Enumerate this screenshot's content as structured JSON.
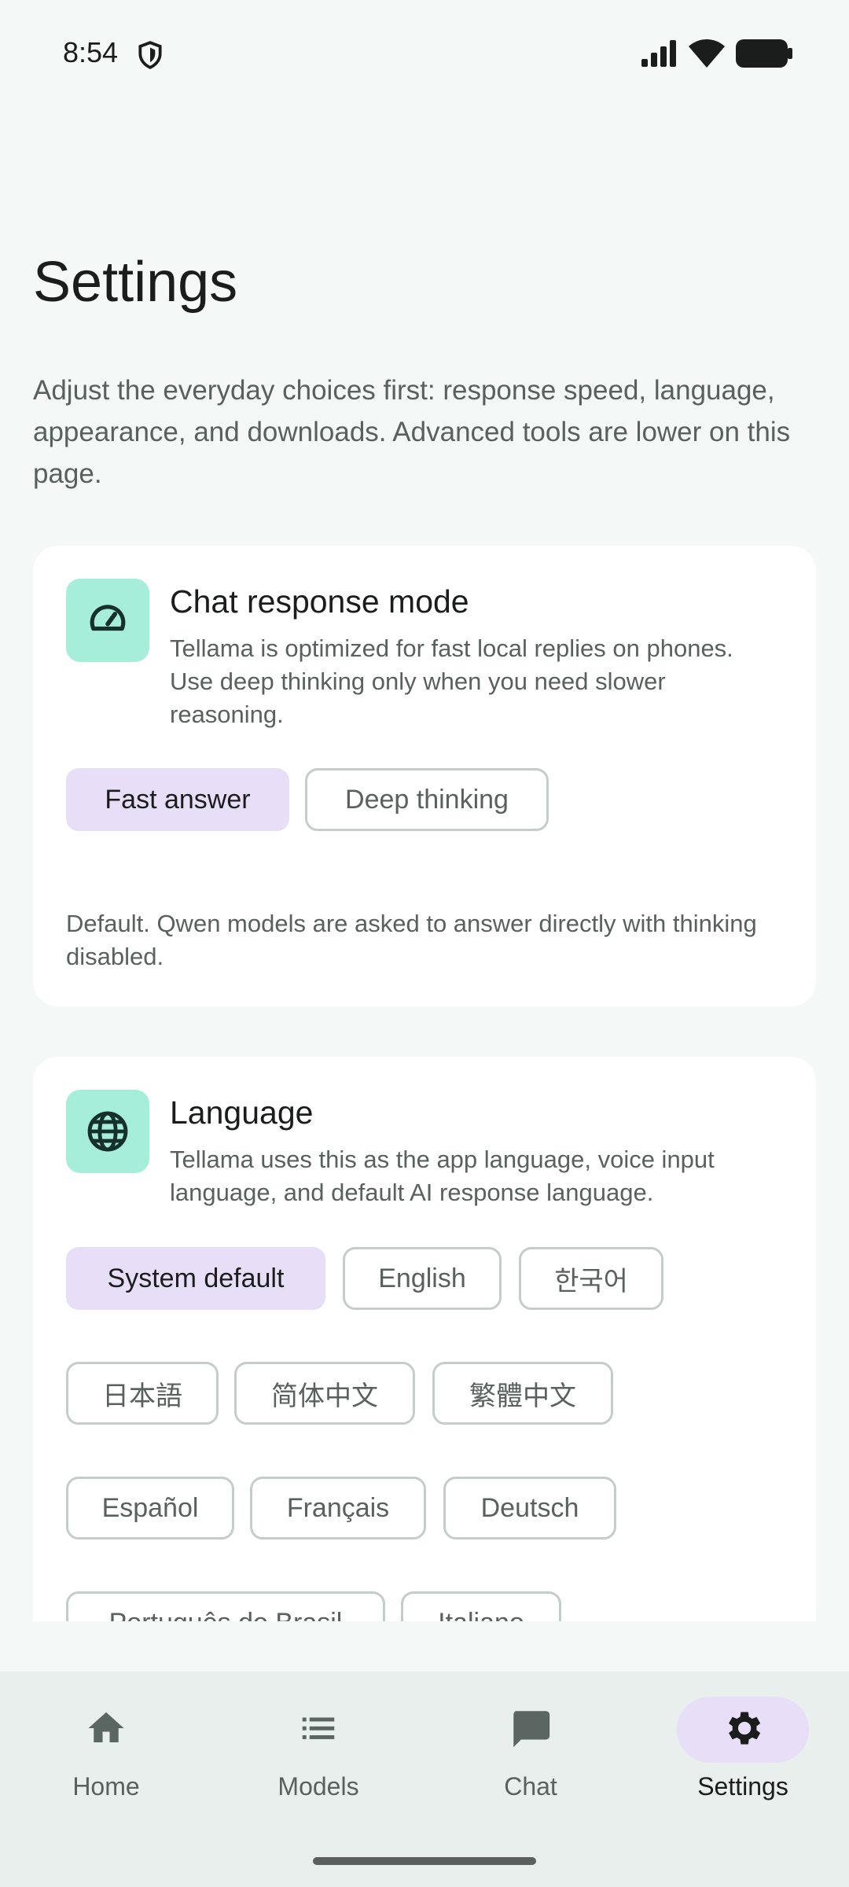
{
  "status_bar": {
    "time": "8:54"
  },
  "header": {
    "title": "Settings",
    "description": "Adjust the everyday choices first: response speed, language, appearance, and downloads. Advanced tools are lower on this page."
  },
  "response_card": {
    "title": "Chat response mode",
    "description": "Tellama is optimized for fast local replies on phones. Use deep thinking only when you need slower reasoning.",
    "options": [
      {
        "label": "Fast answer",
        "selected": true
      },
      {
        "label": "Deep thinking",
        "selected": false
      }
    ],
    "note": "Default. Qwen models are asked to answer directly with thinking disabled.",
    "icon": "speedometer-icon"
  },
  "language_card": {
    "title": "Language",
    "description": "Tellama uses this as the app language, voice input language, and default AI response language.",
    "icon": "globe-icon",
    "options": [
      {
        "label": "System default",
        "selected": true
      },
      {
        "label": "English"
      },
      {
        "label": "한국어"
      },
      {
        "label": "日本語"
      },
      {
        "label": "简体中文"
      },
      {
        "label": "繁體中文"
      },
      {
        "label": "Español"
      },
      {
        "label": "Français"
      },
      {
        "label": "Deutsch"
      },
      {
        "label": "Português do Brasil"
      },
      {
        "label": "Italiano"
      }
    ]
  },
  "bottom_nav": {
    "items": [
      {
        "label": "Home",
        "icon": "home-icon"
      },
      {
        "label": "Models",
        "icon": "list-icon"
      },
      {
        "label": "Chat",
        "icon": "chat-icon"
      },
      {
        "label": "Settings",
        "icon": "gear-icon",
        "active": true
      }
    ]
  },
  "colors": {
    "background": "#f4f8f6",
    "accent_selected": "#e8def8",
    "icon_tile": "#a6eed9",
    "nav_background": "#e9efed"
  }
}
